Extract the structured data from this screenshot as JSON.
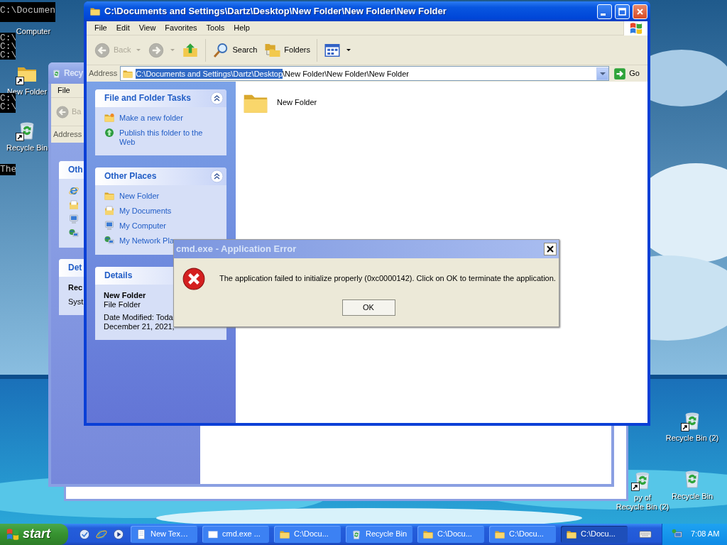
{
  "console_fragments": [
    {
      "lines": [
        "C:\\Documen"
      ]
    },
    {
      "lines": [
        "C:\\",
        "C:\\",
        "C:\\"
      ]
    },
    {
      "lines": [
        "C:\\",
        "C:\\"
      ]
    },
    {
      "lines": [
        "The"
      ]
    }
  ],
  "desktop_icons": [
    {
      "label_lines": [
        "Computer"
      ]
    },
    {
      "kind": "folder",
      "label_lines": [
        "New Folder"
      ],
      "shortcut": true
    },
    {
      "kind": "recycle",
      "label_lines": [
        "Recycle Bin"
      ],
      "shortcut": true
    },
    {
      "kind": "recycle",
      "label_lines": [
        "Recycle Bin (2)"
      ],
      "shortcut": true
    },
    {
      "kind": "recycle",
      "label_lines": [
        "py of",
        "Recycle Bin (2)"
      ],
      "shortcut": true
    },
    {
      "kind": "recycle",
      "label_lines": [
        "Recycle Bin"
      ],
      "shortcut": false
    }
  ],
  "back_window": {
    "title": "Recy",
    "menu": [
      "File"
    ],
    "back_label": "Ba",
    "address_label": "Address",
    "panels": [
      {
        "title": "Oth"
      },
      {
        "title": "Det",
        "lines": [
          "Rec",
          "Syst"
        ]
      }
    ]
  },
  "explorer": {
    "title": "C:\\Documents and Settings\\Dartz\\Desktop\\New Folder\\New Folder\\New Folder",
    "menu": [
      "File",
      "Edit",
      "View",
      "Favorites",
      "Tools",
      "Help"
    ],
    "toolbar": [
      {
        "kind": "back",
        "label": "Back",
        "disabled": true,
        "dropdown": true
      },
      {
        "kind": "forward",
        "disabled": true,
        "dropdown": true
      },
      {
        "kind": "up",
        "disabled": false,
        "dropdown": false
      },
      {
        "kind": "search",
        "label": "Search",
        "disabled": false,
        "dropdown": false
      },
      {
        "kind": "folders",
        "label": "Folders",
        "disabled": false,
        "dropdown": false
      },
      {
        "kind": "views",
        "disabled": false,
        "dropdown": true
      }
    ],
    "address": {
      "label": "Address",
      "segments": [
        {
          "text": "C:\\Documents and Settings\\Dartz\\Desktop",
          "selected": true
        },
        {
          "text": "\\New Folder\\New Folder\\New Folder",
          "selected": false
        }
      ],
      "go": "Go"
    },
    "panels": [
      {
        "title": "File and Folder Tasks",
        "expanded": true,
        "links": [
          {
            "kind": "newfolder",
            "text": "Make a new folder"
          },
          {
            "kind": "publish",
            "text": "Publish this folder to the Web"
          }
        ]
      },
      {
        "title": "Other Places",
        "expanded": true,
        "links": [
          {
            "kind": "folder",
            "text": "New Folder"
          },
          {
            "kind": "documents",
            "text": "My Documents"
          },
          {
            "kind": "computer",
            "text": "My Computer"
          },
          {
            "kind": "network",
            "text": "My Network Pla"
          }
        ]
      },
      {
        "title": "Details",
        "details": {
          "name": "New Folder",
          "type": "File Folder",
          "lines": [
            "Date Modified: Toda",
            "December 21, 2021,"
          ]
        }
      }
    ],
    "files": [
      {
        "kind": "folder",
        "name": "New Folder"
      }
    ]
  },
  "dialog": {
    "title": "cmd.exe - Application Error",
    "message": "The application failed to initialize properly (0xc0000142). Click on OK to terminate the application.",
    "buttons": [
      "OK"
    ]
  },
  "taskbar": {
    "start": "start",
    "quick_launch": [
      {
        "kind": "desktop"
      },
      {
        "kind": "ie"
      },
      {
        "kind": "media"
      }
    ],
    "tasks": [
      {
        "kind": "notepad",
        "label": "New Tex…",
        "selected": false
      },
      {
        "kind": "cmd",
        "label": "cmd.exe ...",
        "selected": false
      },
      {
        "kind": "folder",
        "label": "C:\\Docu...",
        "selected": false
      },
      {
        "kind": "recycle",
        "label": "Recycle Bin",
        "selected": false
      },
      {
        "kind": "folder",
        "label": "C:\\Docu...",
        "selected": false
      },
      {
        "kind": "folder",
        "label": "C:\\Docu...",
        "selected": false
      },
      {
        "kind": "folder",
        "label": "C:\\Docu...",
        "selected": true
      }
    ],
    "clock": "7:08 AM"
  }
}
